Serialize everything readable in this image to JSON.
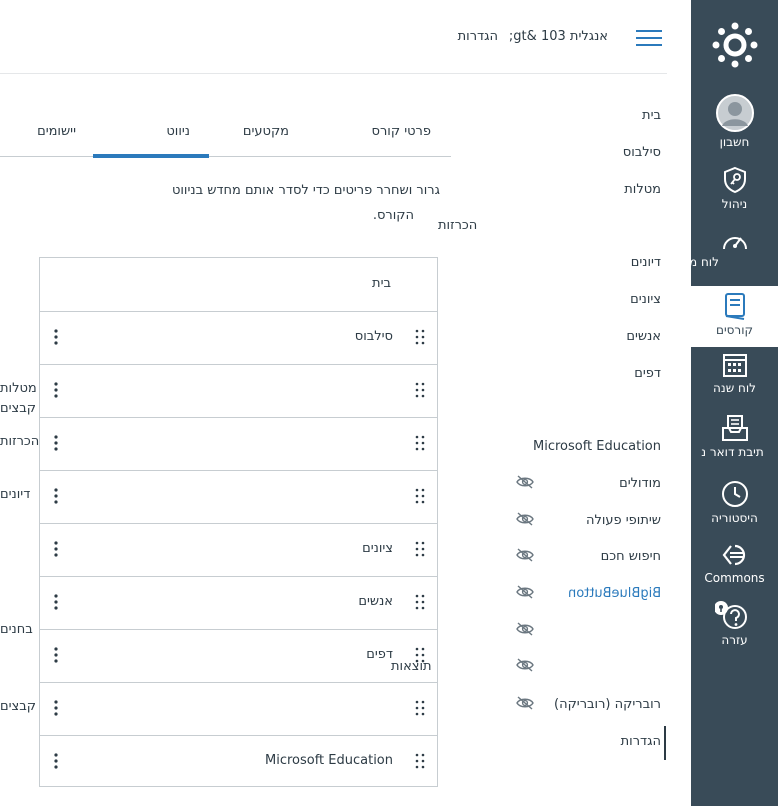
{
  "header": {
    "breadcrumb_course": "אנגלית 103 &gt;",
    "breadcrumb_settings": "הגדרות"
  },
  "global_nav": {
    "items": [
      {
        "label": "חשבון",
        "icon": "avatar-icon"
      },
      {
        "label": "ניהול",
        "icon": "shield-key-icon"
      },
      {
        "label": "לוח מ",
        "icon": "dashboard-gauge-icon"
      },
      {
        "label": "קורסים",
        "icon": "book-icon",
        "active": true
      },
      {
        "label": "לוח שנה",
        "icon": "calendar-icon"
      },
      {
        "label": "תיבת דואר נ",
        "icon": "inbox-icon"
      },
      {
        "label": "היסטוריה",
        "icon": "clock-icon"
      },
      {
        "label": "Commons",
        "icon": "commons-icon"
      },
      {
        "label": "עזרה",
        "icon": "help-icon"
      }
    ]
  },
  "course_nav": {
    "items": [
      {
        "label": "בית"
      },
      {
        "label": "סילבוס"
      },
      {
        "label": "מטלות"
      },
      {
        "label": "הכרזות"
      },
      {
        "label": "דיונים"
      },
      {
        "label": "ציונים"
      },
      {
        "label": "אנשים"
      },
      {
        "label": "דפים"
      },
      {
        "label": "Microsoft Education"
      },
      {
        "label": "מודולים",
        "hidden": true
      },
      {
        "label": "שיתופי פעולה",
        "hidden": true
      },
      {
        "label": "חיפוש חכם",
        "hidden": true
      },
      {
        "label": "BigBlueButton",
        "hidden": true,
        "link": true
      },
      {
        "label": "",
        "hidden": true
      },
      {
        "label": "",
        "hidden": true
      },
      {
        "label": "רובריקה (רובריקה)",
        "hidden": true
      },
      {
        "label": "הגדרות",
        "current": true
      }
    ]
  },
  "tabs": [
    {
      "label": "פרטי קורס"
    },
    {
      "label": "מקטעים"
    },
    {
      "label": "ניווט",
      "active": true
    },
    {
      "label": "יישומים"
    }
  ],
  "instructions": {
    "line1": "גרור ושחרר פריטים כדי לסדר אותם מחדש בניווט",
    "line2": "הקורס."
  },
  "nav_list": {
    "rows": [
      {
        "label": "בית",
        "fixed": true
      },
      {
        "label": "סילבוס"
      },
      {
        "label": ""
      },
      {
        "label": ""
      },
      {
        "label": ""
      },
      {
        "label": "ציונים"
      },
      {
        "label": "אנשים"
      },
      {
        "label": "דפים"
      },
      {
        "label": ""
      },
      {
        "label": "Microsoft Education"
      }
    ]
  },
  "overflow_labels": {
    "assignments": "מטלות",
    "files_1": "קבצים",
    "announcements": "הכרזות",
    "discussions": "דיונים",
    "quizzes": "בחנים",
    "outcomes": "תוצאות",
    "files_2": "קבצים",
    "announcements_mid": "הכרזות"
  },
  "colors": {
    "global_nav_bg": "#394b58",
    "active_tab_underline": "#2b7abc",
    "link": "#2b7abc"
  }
}
